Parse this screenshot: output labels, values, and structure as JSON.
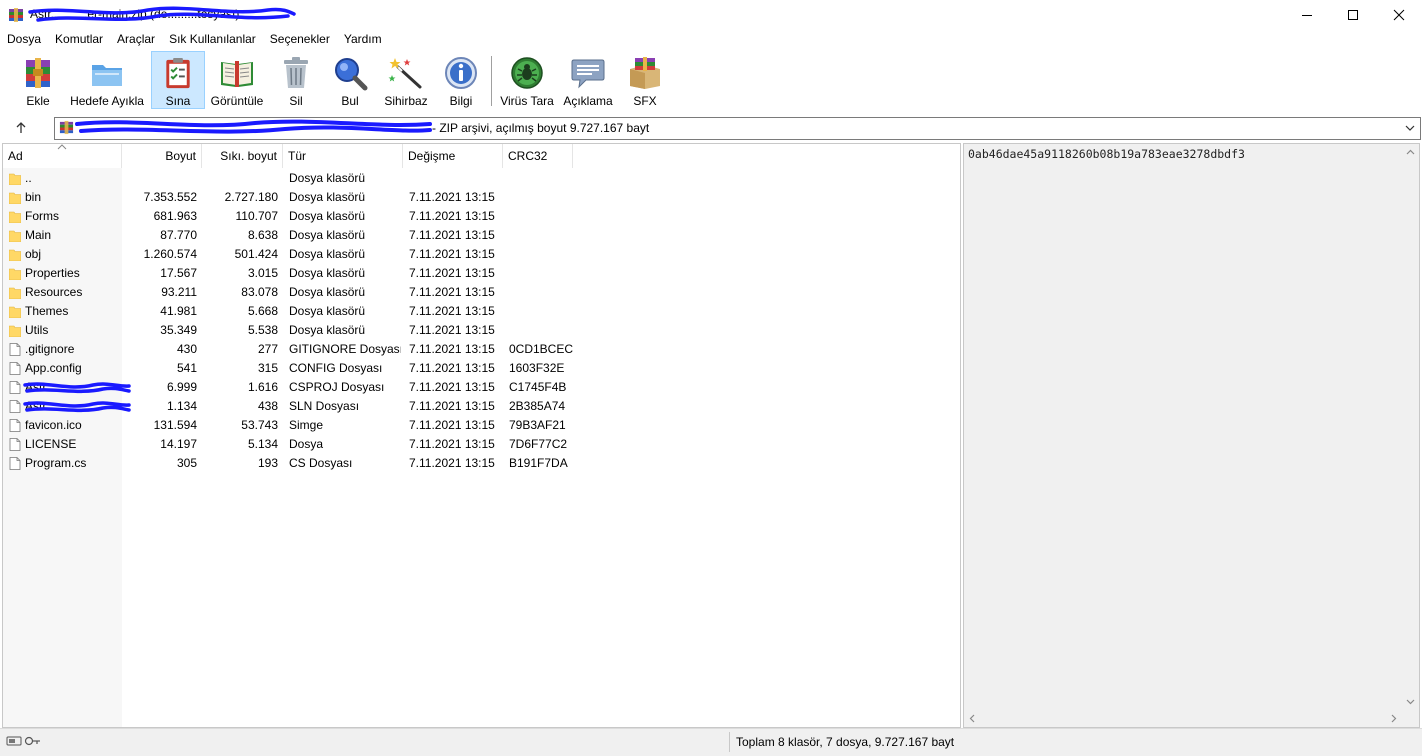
{
  "window": {
    "title": "Astr...........er-main.zip (de.........tosyası)",
    "minimize_label": "minimize",
    "maximize_label": "maximize",
    "close_label": "close"
  },
  "menu": [
    "Dosya",
    "Komutlar",
    "Araçlar",
    "Sık Kullanılanlar",
    "Seçenekler",
    "Yardım"
  ],
  "toolbar": [
    {
      "label": "Ekle",
      "icon": "add-archive-icon"
    },
    {
      "label": "Hedefe Ayıkla",
      "icon": "extract-folder-icon"
    },
    {
      "label": "Sına",
      "icon": "test-clipboard-icon",
      "active": true
    },
    {
      "label": "Görüntüle",
      "icon": "view-book-icon"
    },
    {
      "label": "Sil",
      "icon": "trash-icon"
    },
    {
      "label": "Bul",
      "icon": "find-magnifier-icon"
    },
    {
      "label": "Sihirbaz",
      "icon": "wizard-wand-icon"
    },
    {
      "label": "Bilgi",
      "icon": "info-icon"
    },
    {
      "label": "Virüs Tara",
      "icon": "virus-scan-icon"
    },
    {
      "label": "Açıklama",
      "icon": "comment-icon"
    },
    {
      "label": "SFX",
      "icon": "sfx-box-icon"
    }
  ],
  "address": {
    "text": "- ZIP arşivi, açılmış boyut 9.727.167 bayt"
  },
  "columns": [
    "Ad",
    "Boyut",
    "Sıkı. boyut",
    "Tür",
    "Değişme",
    "CRC32"
  ],
  "files": [
    {
      "name": "..",
      "size": "",
      "packed": "",
      "type": "Dosya klasörü",
      "modified": "",
      "crc": "",
      "kind": "folder"
    },
    {
      "name": "bin",
      "size": "7.353.552",
      "packed": "2.727.180",
      "type": "Dosya klasörü",
      "modified": "7.11.2021 13:15",
      "crc": "",
      "kind": "folder"
    },
    {
      "name": "Forms",
      "size": "681.963",
      "packed": "110.707",
      "type": "Dosya klasörü",
      "modified": "7.11.2021 13:15",
      "crc": "",
      "kind": "folder"
    },
    {
      "name": "Main",
      "size": "87.770",
      "packed": "8.638",
      "type": "Dosya klasörü",
      "modified": "7.11.2021 13:15",
      "crc": "",
      "kind": "folder"
    },
    {
      "name": "obj",
      "size": "1.260.574",
      "packed": "501.424",
      "type": "Dosya klasörü",
      "modified": "7.11.2021 13:15",
      "crc": "",
      "kind": "folder"
    },
    {
      "name": "Properties",
      "size": "17.567",
      "packed": "3.015",
      "type": "Dosya klasörü",
      "modified": "7.11.2021 13:15",
      "crc": "",
      "kind": "folder"
    },
    {
      "name": "Resources",
      "size": "93.211",
      "packed": "83.078",
      "type": "Dosya klasörü",
      "modified": "7.11.2021 13:15",
      "crc": "",
      "kind": "folder"
    },
    {
      "name": "Themes",
      "size": "41.981",
      "packed": "5.668",
      "type": "Dosya klasörü",
      "modified": "7.11.2021 13:15",
      "crc": "",
      "kind": "folder"
    },
    {
      "name": "Utils",
      "size": "35.349",
      "packed": "5.538",
      "type": "Dosya klasörü",
      "modified": "7.11.2021 13:15",
      "crc": "",
      "kind": "folder"
    },
    {
      "name": ".gitignore",
      "size": "430",
      "packed": "277",
      "type": "GITIGNORE Dosyası",
      "modified": "7.11.2021 13:15",
      "crc": "0CD1BCEC",
      "kind": "file"
    },
    {
      "name": "App.config",
      "size": "541",
      "packed": "315",
      "type": "CONFIG Dosyası",
      "modified": "7.11.2021 13:15",
      "crc": "1603F32E",
      "kind": "file"
    },
    {
      "name": "Astr.........",
      "size": "6.999",
      "packed": "1.616",
      "type": "CSPROJ Dosyası",
      "modified": "7.11.2021 13:15",
      "crc": "C1745F4B",
      "kind": "file",
      "redacted": true
    },
    {
      "name": "Astr.........",
      "size": "1.134",
      "packed": "438",
      "type": "SLN Dosyası",
      "modified": "7.11.2021 13:15",
      "crc": "2B385A74",
      "kind": "file",
      "redacted": true
    },
    {
      "name": "favicon.ico",
      "size": "131.594",
      "packed": "53.743",
      "type": "Simge",
      "modified": "7.11.2021 13:15",
      "crc": "79B3AF21",
      "kind": "file"
    },
    {
      "name": "LICENSE",
      "size": "14.197",
      "packed": "5.134",
      "type": "Dosya",
      "modified": "7.11.2021 13:15",
      "crc": "7D6F77C2",
      "kind": "file"
    },
    {
      "name": "Program.cs",
      "size": "305",
      "packed": "193",
      "type": "CS Dosyası",
      "modified": "7.11.2021 13:15",
      "crc": "B191F7DA",
      "kind": "file"
    }
  ],
  "info_pane": {
    "text": "0ab46dae45a9118260b08b19a783eae3278dbdf3"
  },
  "status": {
    "text": "Toplam 8 klasör, 7 dosya, 9.727.167 bayt"
  },
  "colors": {
    "accent": "#cce8ff",
    "folder": "#ffd866",
    "redaction": "#1a1aff"
  }
}
